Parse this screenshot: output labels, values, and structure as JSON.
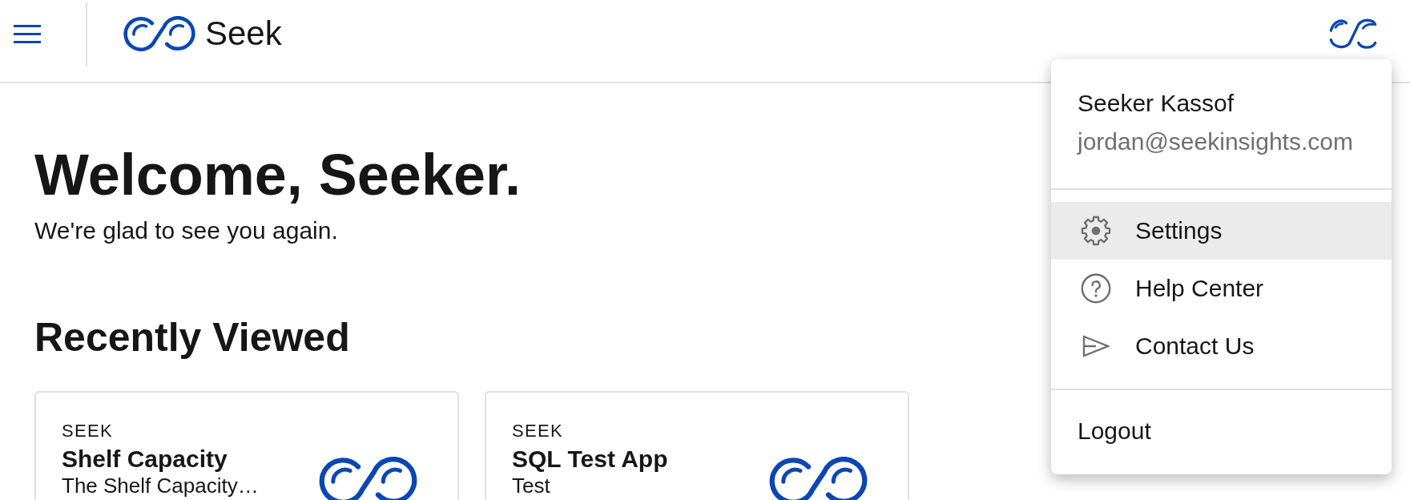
{
  "header": {
    "brand": "Seek"
  },
  "user_menu": {
    "name": "Seeker Kassof",
    "email": "jordan@seekinsights.com",
    "items": [
      {
        "kind": "settings",
        "label": "Settings",
        "selected": true
      },
      {
        "kind": "help",
        "label": "Help Center",
        "selected": false
      },
      {
        "kind": "contact",
        "label": "Contact Us",
        "selected": false
      }
    ],
    "logout": "Logout"
  },
  "welcome": {
    "title": "Welcome, Seeker.",
    "subtitle": "We're glad to see you again."
  },
  "recently_viewed": {
    "title": "Recently Viewed",
    "cards": [
      {
        "category": "SEEK",
        "title": "Shelf Capacity",
        "description": "The Shelf Capacity…"
      },
      {
        "category": "SEEK",
        "title": "SQL Test App",
        "description": "Test"
      }
    ]
  }
}
